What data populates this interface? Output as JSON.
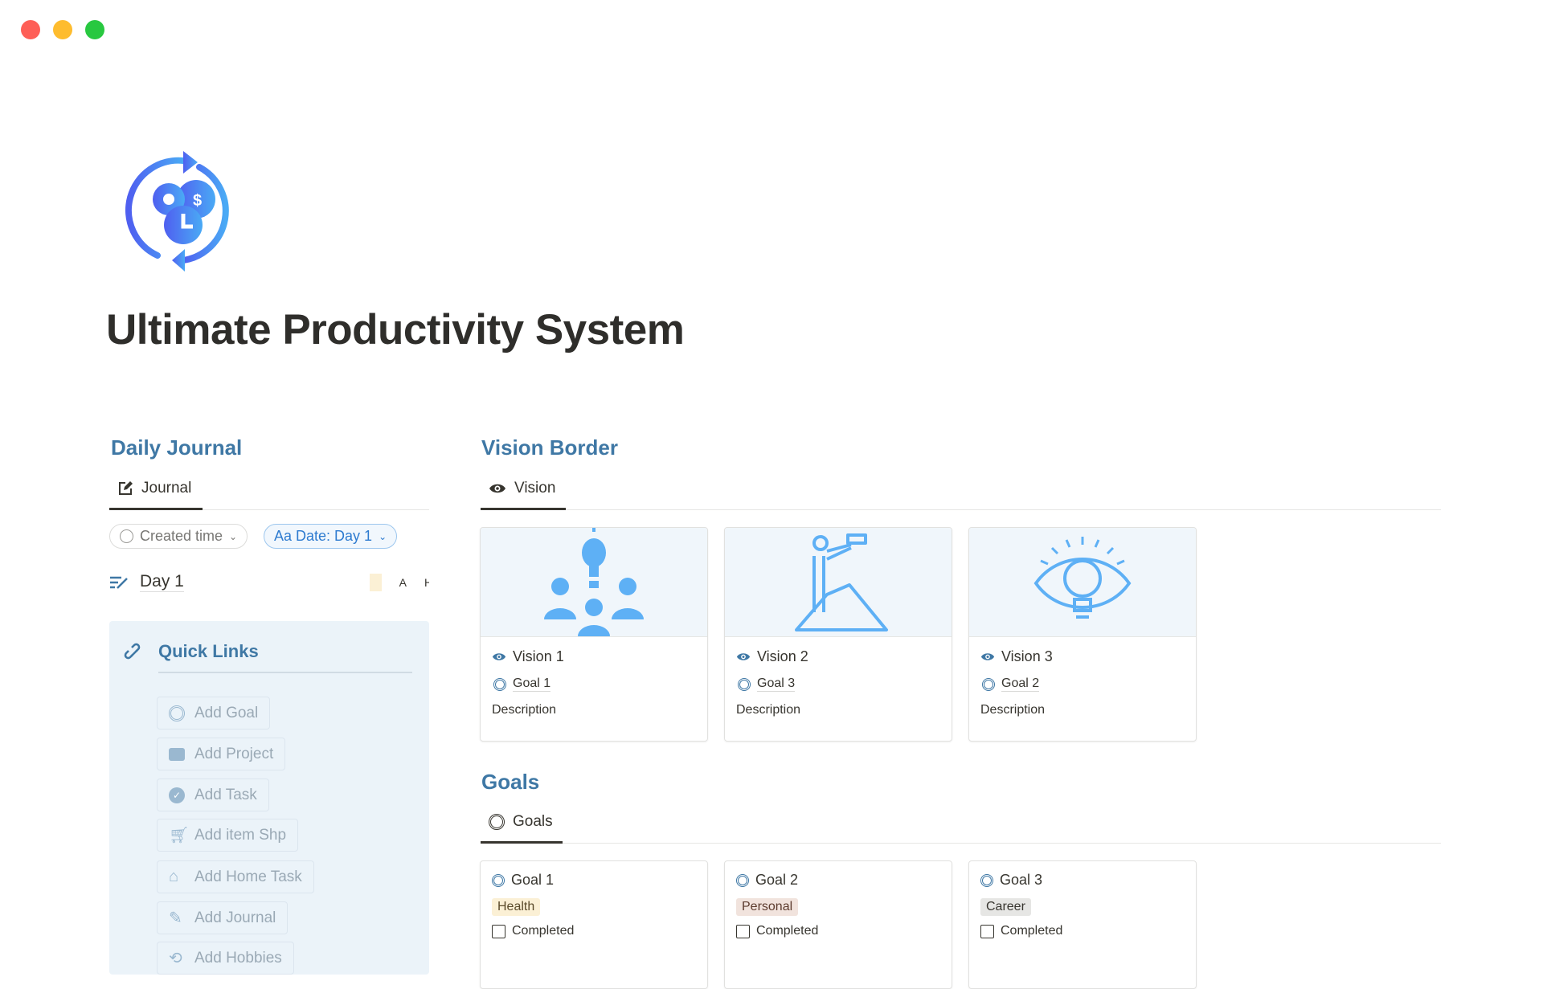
{
  "window": {
    "controls": [
      "close",
      "minimize",
      "maximize"
    ],
    "colors": {
      "close": "#fe5f57",
      "minimize": "#febc2e",
      "maximize": "#28c840"
    }
  },
  "page": {
    "title": "Ultimate Productivity System",
    "icon": "productivity-cycle-icon"
  },
  "accent": "#3f78a5",
  "daily_journal": {
    "heading": "Daily Journal",
    "tab": "Journal",
    "filters": {
      "sort": "Created time",
      "filter": "Aa Date: Day 1"
    },
    "entries": [
      {
        "title": "Day 1",
        "extra": [
          "A",
          "H"
        ]
      }
    ]
  },
  "quick_links": {
    "heading": "Quick Links",
    "buttons": [
      {
        "label": "Add Goal",
        "icon": "target-icon"
      },
      {
        "label": "Add Project",
        "icon": "briefcase-icon"
      },
      {
        "label": "Add Task",
        "icon": "check-circle-icon"
      },
      {
        "label": "Add item Shp",
        "icon": "cart-icon"
      },
      {
        "label": "Add Home Task",
        "icon": "house-icon"
      },
      {
        "label": "Add Journal",
        "icon": "edit-icon"
      },
      {
        "label": "Add Hobbies",
        "icon": "repeat-icon"
      }
    ]
  },
  "vision": {
    "heading": "Vision Border",
    "tab": "Vision",
    "cards": [
      {
        "title": "Vision 1",
        "goal": "Goal 1",
        "description": "Description",
        "image": "idea-people-illustration"
      },
      {
        "title": "Vision 2",
        "goal": "Goal 3",
        "description": "Description",
        "image": "telescope-mountain-illustration"
      },
      {
        "title": "Vision 3",
        "goal": "Goal 2",
        "description": "Description",
        "image": "eye-bulb-illustration"
      }
    ]
  },
  "goals": {
    "heading": "Goals",
    "tab": "Goals",
    "cards": [
      {
        "title": "Goal 1",
        "tag": "Health",
        "tag_bg": "#fbf0d5",
        "tag_fg": "#5a4a2a",
        "completed_label": "Completed",
        "completed": false
      },
      {
        "title": "Goal 2",
        "tag": "Personal",
        "tag_bg": "#f1e3dd",
        "tag_fg": "#5c3b2e",
        "completed_label": "Completed",
        "completed": false
      },
      {
        "title": "Goal 3",
        "tag": "Career",
        "tag_bg": "#e6e6e4",
        "tag_fg": "#37352f",
        "completed_label": "Completed",
        "completed": false
      }
    ]
  }
}
